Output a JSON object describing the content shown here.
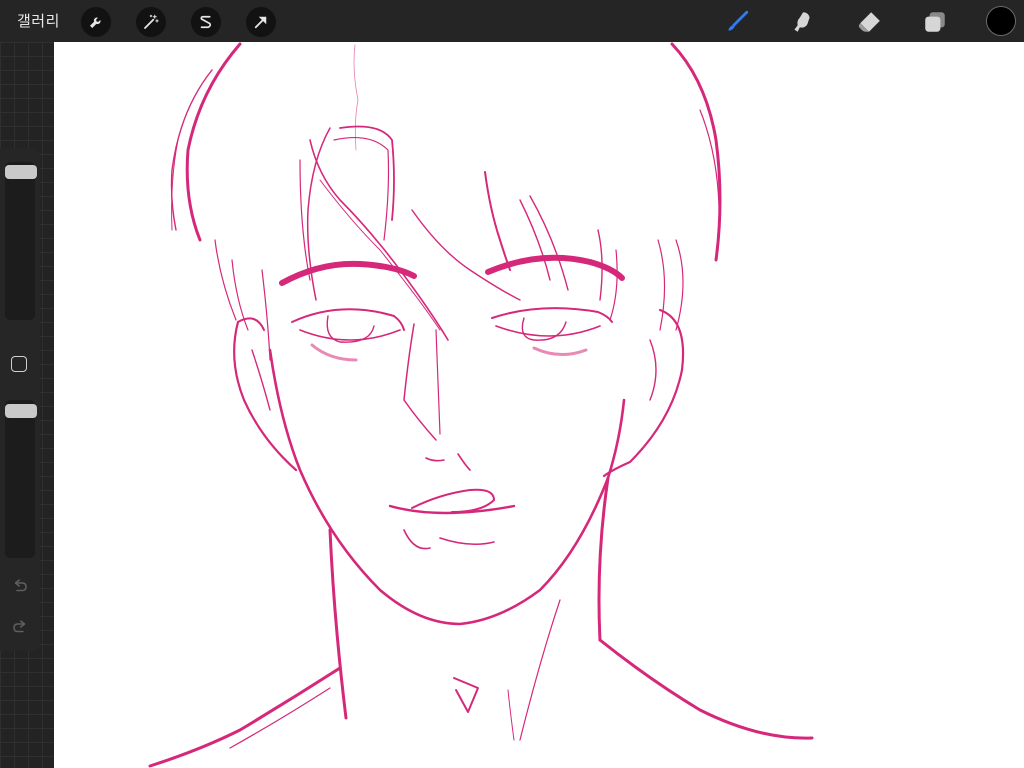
{
  "toolbar": {
    "gallery_label": "갤러리",
    "left_tools": [
      {
        "name": "actions",
        "icon": "wrench-icon"
      },
      {
        "name": "adjustments",
        "icon": "magic-wand-icon"
      },
      {
        "name": "selection",
        "icon": "selection-s-icon"
      },
      {
        "name": "transform",
        "icon": "arrow-cursor-icon"
      }
    ],
    "right_tools": [
      {
        "name": "brush",
        "icon": "brush-icon",
        "active": true
      },
      {
        "name": "smudge",
        "icon": "smudge-finger-icon"
      },
      {
        "name": "eraser",
        "icon": "eraser-icon"
      },
      {
        "name": "layers",
        "icon": "layers-icon"
      }
    ],
    "current_color": "#000000",
    "active_tool_color": "#2f7bf5"
  },
  "sidebar": {
    "brush_size_level": 0.97,
    "opacity_level": 0.97,
    "modify_icon": "square-icon",
    "undo_icon": "undo-arrow-icon",
    "redo_icon": "redo-arrow-icon"
  },
  "canvas": {
    "background": "#ffffff",
    "stroke_color": "#d6287a"
  }
}
